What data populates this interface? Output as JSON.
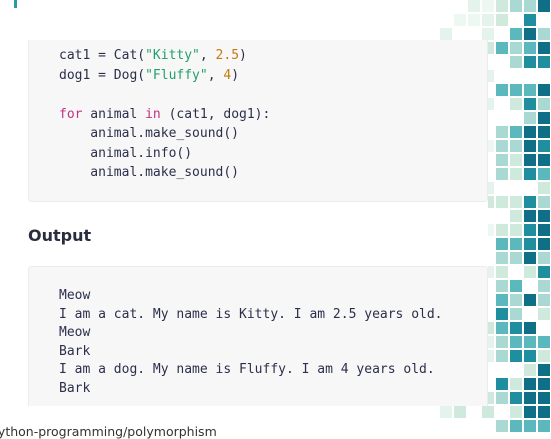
{
  "code": {
    "line1": {
      "var": "cat1 = Cat(",
      "arg1": "\"Kitty\"",
      "sep": ", ",
      "arg2": "2.5",
      "end": ")"
    },
    "line2": {
      "var": "dog1 = Dog(",
      "arg1": "\"Fluffy\"",
      "sep": ", ",
      "arg2": "4",
      "end": ")"
    },
    "line4": {
      "kw1": "for",
      "mid": " animal ",
      "kw2": "in",
      "rest": " (cat1, dog1):"
    },
    "line5": "    animal.make_sound()",
    "line6": "    animal.info()",
    "line7": "    animal.make_sound()"
  },
  "output": {
    "heading": "Output",
    "lines": [
      "Meow",
      "I am a cat. My name is Kitty. I am 2.5 years old.",
      "Meow",
      "Bark",
      "I am a dog. My name is Fluffy. I am 4 years old.",
      "Bark"
    ]
  },
  "footer": {
    "url_fragment": "python-programming/polymorphism"
  },
  "colors": {
    "accent": "#2a9d9f",
    "keyword": "#c3317f",
    "string": "#22a06b",
    "number": "#c47a10"
  }
}
